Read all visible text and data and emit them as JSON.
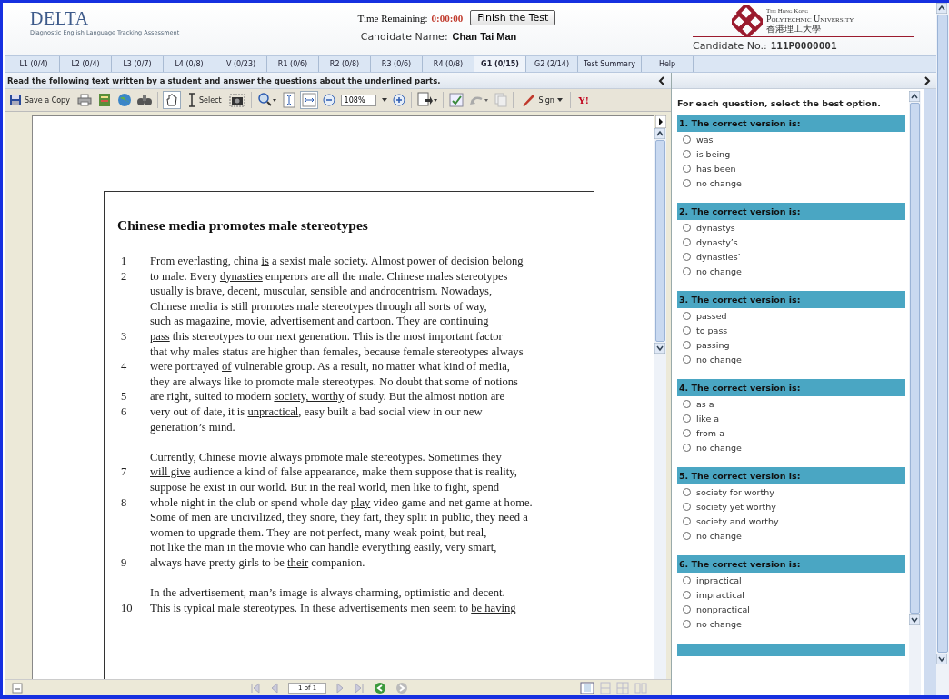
{
  "header": {
    "logo": "DELTA",
    "logo_subtitle": "Diagnostic English Language Tracking Assessment",
    "time_label": "Time Remaining:",
    "time_value": "0:00:00",
    "finish_button": "Finish the Test",
    "candidate_name_label": "Candidate Name:",
    "candidate_name": "Chan Tai Man",
    "university_line1": "The Hong Kong",
    "university_line2": "Polytechnic University",
    "university_chinese": "香港理工大學",
    "candidate_no_label": "Candidate No.:",
    "candidate_no": "111P0000001"
  },
  "tabs": [
    {
      "label": "L1 (0/4)",
      "selected": false
    },
    {
      "label": "L2 (0/4)",
      "selected": false
    },
    {
      "label": "L3 (0/7)",
      "selected": false
    },
    {
      "label": "L4 (0/8)",
      "selected": false
    },
    {
      "label": "V (0/23)",
      "selected": false
    },
    {
      "label": "R1 (0/6)",
      "selected": false
    },
    {
      "label": "R2 (0/8)",
      "selected": false
    },
    {
      "label": "R3 (0/6)",
      "selected": false
    },
    {
      "label": "R4 (0/8)",
      "selected": false
    },
    {
      "label": "G1 (0/15)",
      "selected": true
    },
    {
      "label": "G2 (2/14)",
      "selected": false
    },
    {
      "label": "Test Summary",
      "selected": false
    },
    {
      "label": "Help",
      "selected": false
    }
  ],
  "instruction": "Read the following text written by a student and answer the questions about the underlined parts.",
  "toolbar": {
    "save_label": "Save a Copy",
    "select_label": "Select",
    "zoom": "108%",
    "sign_label": "Sign",
    "yahoo_label": "Y!"
  },
  "document": {
    "title": "Chinese media promotes male stereotypes",
    "paragraphs": [
      [
        {
          "number": "1",
          "segments": [
            {
              "text": "From everlasting, china ",
              "underline": false
            },
            {
              "text": "is",
              "underline": true
            },
            {
              "text": " a sexist male society. Almost power of decision belong",
              "underline": false
            }
          ]
        },
        {
          "number": "2",
          "segments": [
            {
              "text": "to male. Every ",
              "underline": false
            },
            {
              "text": "dynasties",
              "underline": true
            },
            {
              "text": " emperors are all the male. Chinese males stereotypes",
              "underline": false
            }
          ]
        },
        {
          "segments": [
            {
              "text": "usually is brave, decent, muscular, sensible and androcentrism. Nowadays,",
              "underline": false
            }
          ]
        },
        {
          "segments": [
            {
              "text": "Chinese media is still promotes male stereotypes through all sorts of way,",
              "underline": false
            }
          ]
        },
        {
          "segments": [
            {
              "text": "such as magazine, movie, advertisement and cartoon. They are continuing",
              "underline": false
            }
          ]
        },
        {
          "number": "3",
          "segments": [
            {
              "text": "pass",
              "underline": true
            },
            {
              "text": " this stereotypes to our next generation. This is the most important factor",
              "underline": false
            }
          ]
        },
        {
          "segments": [
            {
              "text": "that why males status are higher than females, because female stereotypes always",
              "underline": false
            }
          ]
        },
        {
          "number": "4",
          "segments": [
            {
              "text": "were portrayed ",
              "underline": false
            },
            {
              "text": "of",
              "underline": true
            },
            {
              "text": " vulnerable group. As a result, no matter what kind of media,",
              "underline": false
            }
          ]
        },
        {
          "segments": [
            {
              "text": "they are always like to promote male stereotypes. No doubt that some of notions",
              "underline": false
            }
          ]
        },
        {
          "number": "5",
          "segments": [
            {
              "text": "are right, suited to modern ",
              "underline": false
            },
            {
              "text": "society, worthy",
              "underline": true
            },
            {
              "text": " of study. But the almost notion are",
              "underline": false
            }
          ]
        },
        {
          "number": "6",
          "segments": [
            {
              "text": "very out of date, it is ",
              "underline": false
            },
            {
              "text": "unpractical",
              "underline": true
            },
            {
              "text": ", easy built a bad social view in our new",
              "underline": false
            }
          ]
        },
        {
          "segments": [
            {
              "text": "generation’s mind.",
              "underline": false
            }
          ]
        }
      ],
      [
        {
          "segments": [
            {
              "text": "Currently, Chinese movie always promote male stereotypes. Sometimes they",
              "underline": false
            }
          ]
        },
        {
          "number": "7",
          "segments": [
            {
              "text": "will give",
              "underline": true
            },
            {
              "text": " audience a kind of false appearance, make them suppose that is reality,",
              "underline": false
            }
          ]
        },
        {
          "segments": [
            {
              "text": "suppose he exist in our world. But in the real world, men like to fight, spend",
              "underline": false
            }
          ]
        },
        {
          "number": "8",
          "segments": [
            {
              "text": "whole night in the club or spend whole day ",
              "underline": false
            },
            {
              "text": "play",
              "underline": true
            },
            {
              "text": " video game and net game at home.",
              "underline": false
            }
          ]
        },
        {
          "segments": [
            {
              "text": "Some of men are uncivilized, they snore, they fart, they split in public, they need a",
              "underline": false
            }
          ]
        },
        {
          "segments": [
            {
              "text": "women to upgrade them. They are not perfect, many weak point, but real,",
              "underline": false
            }
          ]
        },
        {
          "segments": [
            {
              "text": "not like the man in the movie who can handle everything easily, very smart,",
              "underline": false
            }
          ]
        },
        {
          "number": "9",
          "segments": [
            {
              "text": "always have pretty girls to be ",
              "underline": false
            },
            {
              "text": "their",
              "underline": true
            },
            {
              "text": " companion.",
              "underline": false
            }
          ]
        }
      ],
      [
        {
          "segments": [
            {
              "text": "In the advertisement, man’s image is always charming, optimistic and decent.",
              "underline": false
            }
          ]
        },
        {
          "number": "10",
          "segments": [
            {
              "text": "This is typical male stereotypes. In these advertisements men seem to ",
              "underline": false
            },
            {
              "text": "be having",
              "underline": true
            }
          ]
        }
      ]
    ]
  },
  "page_indicator": "1 of 1",
  "questions_panel": {
    "intro": "For each question, select the best option.",
    "questions": [
      {
        "title": "1. The correct version is:",
        "options": [
          {
            "label": "was",
            "selected": false
          },
          {
            "label": "is being",
            "selected": false
          },
          {
            "label": "has been",
            "selected": false
          },
          {
            "label": "no change",
            "selected": false
          }
        ]
      },
      {
        "title": "2. The correct version is:",
        "options": [
          {
            "label": "dynastys",
            "selected": false
          },
          {
            "label": "dynasty’s",
            "selected": false
          },
          {
            "label": "dynasties’",
            "selected": false
          },
          {
            "label": "no change",
            "selected": false
          }
        ]
      },
      {
        "title": "3. The correct version is:",
        "options": [
          {
            "label": "passed",
            "selected": false
          },
          {
            "label": "to pass",
            "selected": false
          },
          {
            "label": "passing",
            "selected": false
          },
          {
            "label": "no change",
            "selected": false
          }
        ]
      },
      {
        "title": "4. The correct version is:",
        "options": [
          {
            "label": "as a",
            "selected": false
          },
          {
            "label": "like a",
            "selected": false
          },
          {
            "label": "from a",
            "selected": false
          },
          {
            "label": "no change",
            "selected": false
          }
        ]
      },
      {
        "title": "5. The correct version is:",
        "options": [
          {
            "label": "society for worthy",
            "selected": false
          },
          {
            "label": "society yet worthy",
            "selected": false
          },
          {
            "label": "society and worthy",
            "selected": false
          },
          {
            "label": "no change",
            "selected": false
          }
        ]
      },
      {
        "title": "6. The correct version is:",
        "options": [
          {
            "label": "inpractical",
            "selected": false
          },
          {
            "label": "impractical",
            "selected": false
          },
          {
            "label": "nonpractical",
            "selected": false
          },
          {
            "label": "no change",
            "selected": false
          }
        ]
      }
    ]
  }
}
